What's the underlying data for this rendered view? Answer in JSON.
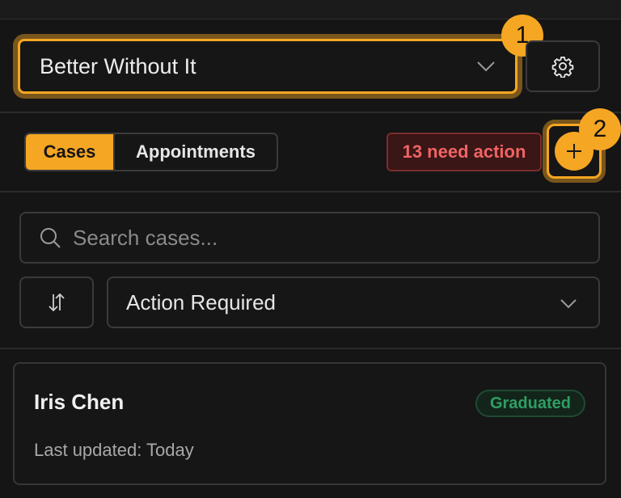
{
  "header": {
    "org_selector": {
      "value": "Better Without It"
    },
    "settings_icon": "gear-icon",
    "callouts": [
      "1",
      "2"
    ]
  },
  "toolbar": {
    "tabs": [
      {
        "label": "Cases",
        "active": true
      },
      {
        "label": "Appointments",
        "active": false
      }
    ],
    "need_action_label": "13 need action",
    "add_icon": "plus-icon"
  },
  "search": {
    "placeholder": "Search cases...",
    "value": ""
  },
  "filters": {
    "sort_icon": "sort-arrows-icon",
    "status_filter": "Action Required"
  },
  "cases": [
    {
      "name": "Iris Chen",
      "status": "Graduated",
      "updated": "Last updated: Today"
    }
  ],
  "colors": {
    "accent": "#f5a623",
    "background": "#151515",
    "danger": "#ef6464",
    "success": "#2f9e63"
  }
}
